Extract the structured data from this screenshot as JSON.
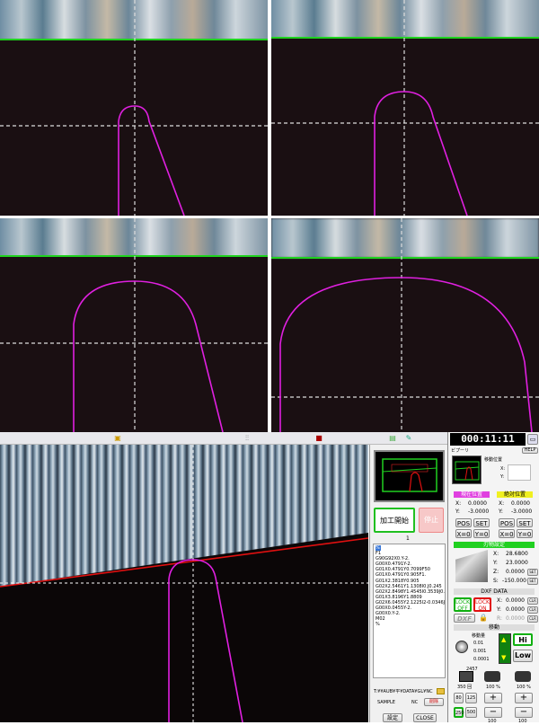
{
  "timer": "000:11:11",
  "right_panel": {
    "title": "ビプーリ",
    "help": "HELP",
    "pos_label": "移動位置",
    "coord_x_label": "X:",
    "coord_y_label": "Y:",
    "left_header": "現在位置",
    "right_header": "絶対位置",
    "left_x": "0.0000",
    "left_y": "-3.0000",
    "right_x": "0.0000",
    "right_y": "-3.0000",
    "pos_btn": "POS",
    "set_btn": "SET",
    "x0_btn": "X=0",
    "y0_btn": "Y=0",
    "tool_header": "刃物設定",
    "tool_x_label": "X:",
    "tool_y_label": "Y:",
    "tool_z_label": "Z:",
    "tool_s_label": "S:",
    "tool_x": "28.6800",
    "tool_y": "23.0000",
    "tool_z": "0.0000",
    "tool_s": "-150.000",
    "dxf_header": "DXF DATA",
    "lock_off": "LOCK OFF",
    "lock_on": "LOCK ON",
    "dxf_btn": "DXF",
    "dxf_x": "0.0000",
    "dxf_y": "0.0000",
    "dxf_r": "0.0000",
    "clr": "CLR",
    "manual_header": "移動",
    "step_label": "移動量",
    "step_opts": [
      "0.01",
      "0.001",
      "0.0001"
    ],
    "hi": "Hi",
    "low": "Low",
    "counter": "2457",
    "speed1": "350 回",
    "speed2": "100 %",
    "speed3": "100 %",
    "btn_80": "80",
    "btn_125": "125",
    "btn_250": "250",
    "btn_500": "500",
    "plus": "+",
    "minus": "−",
    "bottom_label": "100"
  },
  "mid_panel": {
    "start_btn": "加工開始",
    "stop_btn": "停止",
    "page_no": "1",
    "nc_lines": [
      "%",
      "F1",
      "G90G92X0.Y-2.",
      "G00X0.4791Y-2.",
      "G01X0.4791Y0.7099F50",
      "G01X0.4791Y0.905F1.",
      "G01X2.3818Y0.905",
      "G02X2.5461Y1.1308I0.J0.245",
      "G02X2.8498Y1.4545I0.3539J0.02",
      "G01X3.8196Y1.8809",
      "G02X6.0455Y2.1225I2-0.0346J0.242",
      "G00X0.0455Y-2.",
      "G00X0.Y-2.",
      "M02",
      "%"
    ],
    "file_path": "T:¥¥AUB¥平¥DATA¥GL¥NC",
    "sample_label": "SAMPLE",
    "nc_label": "NC",
    "delete_btn": "削除",
    "setting_btn": "設定",
    "close_btn": "CLOSE"
  },
  "colors": {
    "profile": "#e020e0",
    "green_line": "#1fd21f",
    "red_line": "#e01010",
    "header_magenta": "#e040e0",
    "header_yellow": "#f0f020",
    "header_green": "#20d020",
    "lock_green": "#10b010",
    "lock_red": "#e01010"
  }
}
